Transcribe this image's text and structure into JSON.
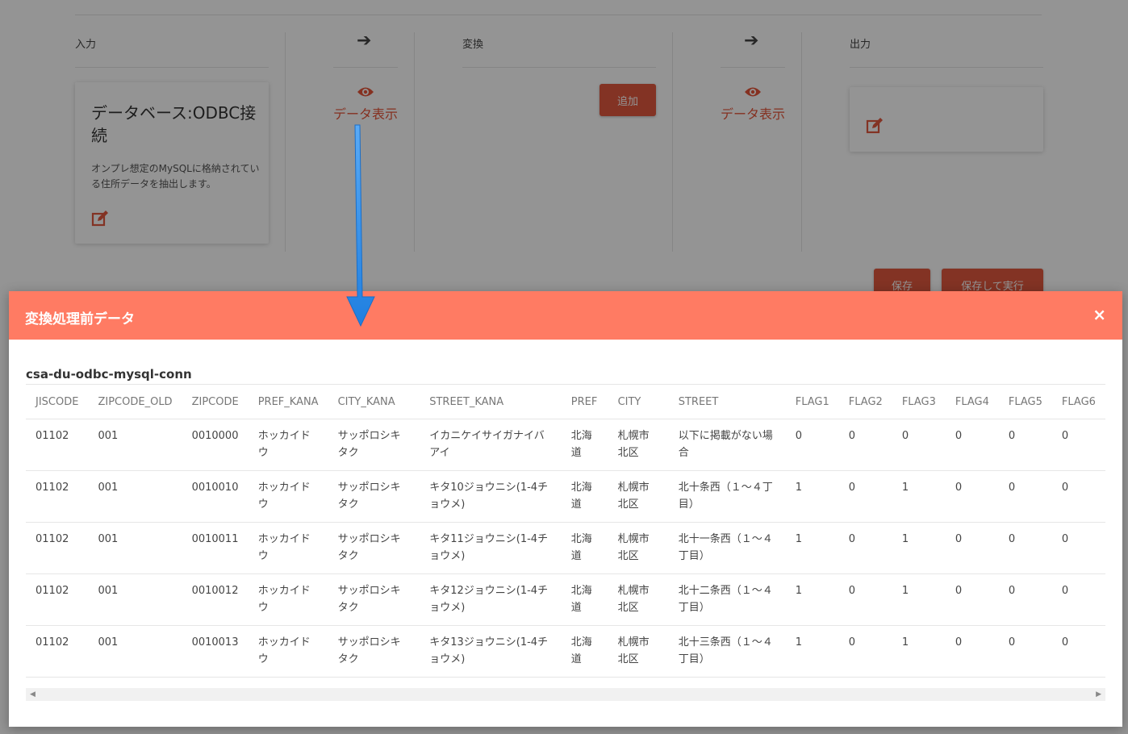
{
  "pipeline": {
    "input_header": "入力",
    "transform_header": "変換",
    "output_header": "出力",
    "source_card": {
      "title": "データベース:ODBC接続",
      "description": "オンプレ想定のMySQLに格納されている住所データを抽出します。"
    },
    "data_view_label_1": "データ表示",
    "data_view_label_2": "データ表示",
    "add_button": "追加",
    "save_button": "保存",
    "save_run_button": "保存して実行"
  },
  "modal": {
    "title": "変換処理前データ",
    "close": "×",
    "connection_name": "csa-du-odbc-mysql-conn",
    "columns": [
      "JISCODE",
      "ZIPCODE_OLD",
      "ZIPCODE",
      "PREF_KANA",
      "CITY_KANA",
      "STREET_KANA",
      "PREF",
      "CITY",
      "STREET",
      "FLAG1",
      "FLAG2",
      "FLAG3",
      "FLAG4",
      "FLAG5",
      "FLAG6"
    ],
    "rows": [
      [
        "01102",
        "001",
        "0010000",
        "ホッカイドウ",
        "サッポロシキタク",
        "イカニケイサイガナイバアイ",
        "北海道",
        "札幌市北区",
        "以下に掲載がない場合",
        "0",
        "0",
        "0",
        "0",
        "0",
        "0"
      ],
      [
        "01102",
        "001",
        "0010010",
        "ホッカイドウ",
        "サッポロシキタク",
        "キタ10ジョウニシ(1-4チョウメ)",
        "北海道",
        "札幌市北区",
        "北十条西（１～４丁目）",
        "1",
        "0",
        "1",
        "0",
        "0",
        "0"
      ],
      [
        "01102",
        "001",
        "0010011",
        "ホッカイドウ",
        "サッポロシキタク",
        "キタ11ジョウニシ(1-4チョウメ)",
        "北海道",
        "札幌市北区",
        "北十一条西（１～４丁目）",
        "1",
        "0",
        "1",
        "0",
        "0",
        "0"
      ],
      [
        "01102",
        "001",
        "0010012",
        "ホッカイドウ",
        "サッポロシキタク",
        "キタ12ジョウニシ(1-4チョウメ)",
        "北海道",
        "札幌市北区",
        "北十二条西（１～４丁目）",
        "1",
        "0",
        "1",
        "0",
        "0",
        "0"
      ],
      [
        "01102",
        "001",
        "0010013",
        "ホッカイドウ",
        "サッポロシキタク",
        "キタ13ジョウニシ(1-4チョウメ)",
        "北海道",
        "札幌市北区",
        "北十三条西（１～４丁目）",
        "1",
        "0",
        "1",
        "0",
        "0",
        "0"
      ]
    ]
  },
  "colors": {
    "accent": "#e2583e",
    "modal_header": "#ff7b63",
    "annotation_arrow": "#2b8ef0"
  }
}
